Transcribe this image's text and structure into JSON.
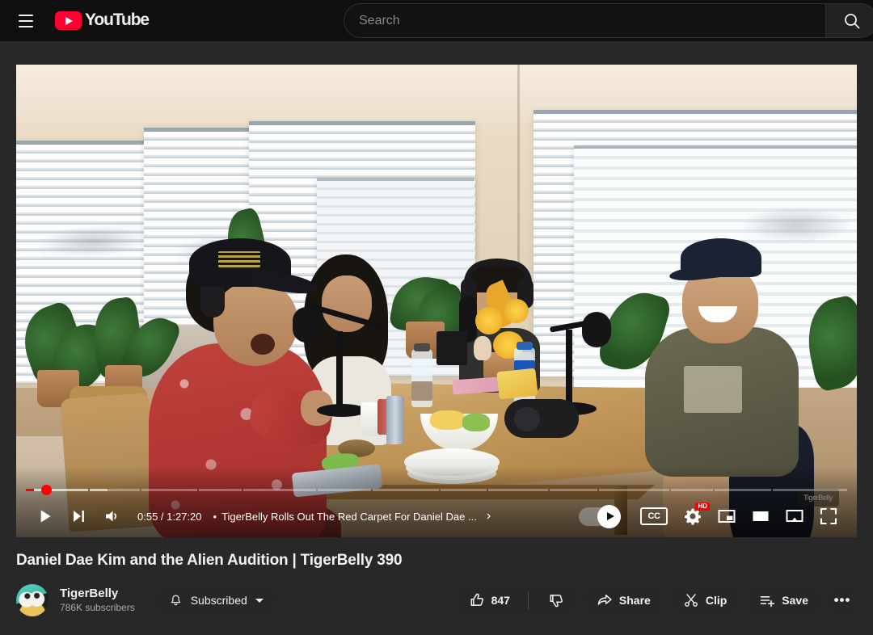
{
  "masthead": {
    "menu_icon": "hamburger-menu-icon",
    "logo_text": "YouTube",
    "logo_icon": "youtube-play-icon",
    "search": {
      "placeholder": "Search",
      "value": "",
      "button_icon": "search-icon"
    }
  },
  "player": {
    "play_state": "paused",
    "play_icon": "play-icon",
    "next_icon": "next-track-icon",
    "volume_icon": "volume-icon",
    "current_time": "0:55",
    "duration": "1:27:20",
    "time_display": "0:55 / 1:27:20",
    "chapter_separator": "•",
    "chapter_title": "TigerBelly Rolls Out The Red Carpet For Daniel Dae ...",
    "chapter_chevron": "›",
    "autoplay_on": true,
    "autoplay_icon": "autoplay-play-icon",
    "cc_label": "CC",
    "settings_icon": "gear-icon",
    "quality_badge": "HD",
    "miniplayer_icon": "miniplayer-icon",
    "theater_icon": "theater-mode-icon",
    "cast_icon": "cast-icon",
    "fullscreen_icon": "fullscreen-icon",
    "progress_percent": 1.05,
    "buffered_percent": 10,
    "chapters": [
      {
        "width_pct": 7.8
      },
      {
        "width_pct": 6.2
      },
      {
        "width_pct": 7.0
      },
      {
        "width_pct": 5.4
      },
      {
        "width_pct": 9.1
      },
      {
        "width_pct": 6.6
      },
      {
        "width_pct": 8.3
      },
      {
        "width_pct": 5.8
      },
      {
        "width_pct": 7.4
      },
      {
        "width_pct": 6.0
      },
      {
        "width_pct": 8.8
      },
      {
        "width_pct": 5.2
      },
      {
        "width_pct": 7.1
      },
      {
        "width_pct": 9.3
      }
    ],
    "watermark": "TigerBelly"
  },
  "video": {
    "title": "Daniel Dae Kim and the Alien Audition | TigerBelly 390"
  },
  "channel": {
    "name": "TigerBelly",
    "subscribers": "786K subscribers",
    "avatar_name": "tigerbelly-channel-avatar",
    "subscribe_label": "Subscribed",
    "bell_icon": "bell-icon",
    "chevron_icon": "chevron-down-icon"
  },
  "actions": {
    "like_count": "847",
    "like_icon": "thumbs-up-icon",
    "dislike_icon": "thumbs-down-icon",
    "share_label": "Share",
    "share_icon": "share-arrow-icon",
    "clip_label": "Clip",
    "clip_icon": "scissors-icon",
    "save_label": "Save",
    "save_icon": "save-list-icon",
    "more_label": "•••",
    "more_icon": "more-horizontal-icon"
  },
  "colors": {
    "brand_red": "#ff0033",
    "progress_red": "#ff0000",
    "page_bg": "#282828",
    "masthead_bg": "#0f0f0f",
    "pill_bg": "#272727",
    "text_primary": "#f1f1f1",
    "text_secondary": "#aaaaaa"
  }
}
